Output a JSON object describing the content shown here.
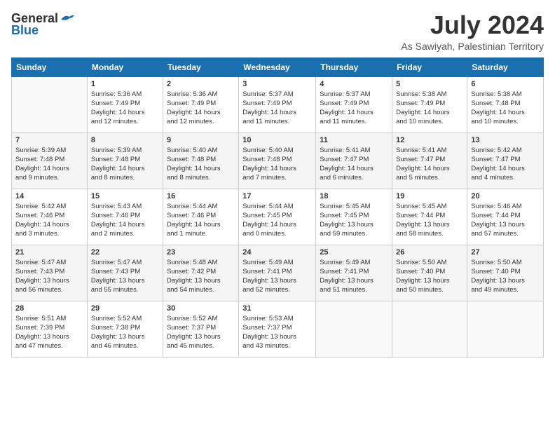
{
  "header": {
    "logo_general": "General",
    "logo_blue": "Blue",
    "month": "July 2024",
    "location": "As Sawiyah, Palestinian Territory"
  },
  "days_of_week": [
    "Sunday",
    "Monday",
    "Tuesday",
    "Wednesday",
    "Thursday",
    "Friday",
    "Saturday"
  ],
  "weeks": [
    [
      {
        "day": "",
        "info": ""
      },
      {
        "day": "1",
        "info": "Sunrise: 5:36 AM\nSunset: 7:49 PM\nDaylight: 14 hours\nand 12 minutes."
      },
      {
        "day": "2",
        "info": "Sunrise: 5:36 AM\nSunset: 7:49 PM\nDaylight: 14 hours\nand 12 minutes."
      },
      {
        "day": "3",
        "info": "Sunrise: 5:37 AM\nSunset: 7:49 PM\nDaylight: 14 hours\nand 11 minutes."
      },
      {
        "day": "4",
        "info": "Sunrise: 5:37 AM\nSunset: 7:49 PM\nDaylight: 14 hours\nand 11 minutes."
      },
      {
        "day": "5",
        "info": "Sunrise: 5:38 AM\nSunset: 7:49 PM\nDaylight: 14 hours\nand 10 minutes."
      },
      {
        "day": "6",
        "info": "Sunrise: 5:38 AM\nSunset: 7:48 PM\nDaylight: 14 hours\nand 10 minutes."
      }
    ],
    [
      {
        "day": "7",
        "info": "Sunrise: 5:39 AM\nSunset: 7:48 PM\nDaylight: 14 hours\nand 9 minutes."
      },
      {
        "day": "8",
        "info": "Sunrise: 5:39 AM\nSunset: 7:48 PM\nDaylight: 14 hours\nand 8 minutes."
      },
      {
        "day": "9",
        "info": "Sunrise: 5:40 AM\nSunset: 7:48 PM\nDaylight: 14 hours\nand 8 minutes."
      },
      {
        "day": "10",
        "info": "Sunrise: 5:40 AM\nSunset: 7:48 PM\nDaylight: 14 hours\nand 7 minutes."
      },
      {
        "day": "11",
        "info": "Sunrise: 5:41 AM\nSunset: 7:47 PM\nDaylight: 14 hours\nand 6 minutes."
      },
      {
        "day": "12",
        "info": "Sunrise: 5:41 AM\nSunset: 7:47 PM\nDaylight: 14 hours\nand 5 minutes."
      },
      {
        "day": "13",
        "info": "Sunrise: 5:42 AM\nSunset: 7:47 PM\nDaylight: 14 hours\nand 4 minutes."
      }
    ],
    [
      {
        "day": "14",
        "info": "Sunrise: 5:42 AM\nSunset: 7:46 PM\nDaylight: 14 hours\nand 3 minutes."
      },
      {
        "day": "15",
        "info": "Sunrise: 5:43 AM\nSunset: 7:46 PM\nDaylight: 14 hours\nand 2 minutes."
      },
      {
        "day": "16",
        "info": "Sunrise: 5:44 AM\nSunset: 7:46 PM\nDaylight: 14 hours\nand 1 minute."
      },
      {
        "day": "17",
        "info": "Sunrise: 5:44 AM\nSunset: 7:45 PM\nDaylight: 14 hours\nand 0 minutes."
      },
      {
        "day": "18",
        "info": "Sunrise: 5:45 AM\nSunset: 7:45 PM\nDaylight: 13 hours\nand 59 minutes."
      },
      {
        "day": "19",
        "info": "Sunrise: 5:45 AM\nSunset: 7:44 PM\nDaylight: 13 hours\nand 58 minutes."
      },
      {
        "day": "20",
        "info": "Sunrise: 5:46 AM\nSunset: 7:44 PM\nDaylight: 13 hours\nand 57 minutes."
      }
    ],
    [
      {
        "day": "21",
        "info": "Sunrise: 5:47 AM\nSunset: 7:43 PM\nDaylight: 13 hours\nand 56 minutes."
      },
      {
        "day": "22",
        "info": "Sunrise: 5:47 AM\nSunset: 7:43 PM\nDaylight: 13 hours\nand 55 minutes."
      },
      {
        "day": "23",
        "info": "Sunrise: 5:48 AM\nSunset: 7:42 PM\nDaylight: 13 hours\nand 54 minutes."
      },
      {
        "day": "24",
        "info": "Sunrise: 5:49 AM\nSunset: 7:41 PM\nDaylight: 13 hours\nand 52 minutes."
      },
      {
        "day": "25",
        "info": "Sunrise: 5:49 AM\nSunset: 7:41 PM\nDaylight: 13 hours\nand 51 minutes."
      },
      {
        "day": "26",
        "info": "Sunrise: 5:50 AM\nSunset: 7:40 PM\nDaylight: 13 hours\nand 50 minutes."
      },
      {
        "day": "27",
        "info": "Sunrise: 5:50 AM\nSunset: 7:40 PM\nDaylight: 13 hours\nand 49 minutes."
      }
    ],
    [
      {
        "day": "28",
        "info": "Sunrise: 5:51 AM\nSunset: 7:39 PM\nDaylight: 13 hours\nand 47 minutes."
      },
      {
        "day": "29",
        "info": "Sunrise: 5:52 AM\nSunset: 7:38 PM\nDaylight: 13 hours\nand 46 minutes."
      },
      {
        "day": "30",
        "info": "Sunrise: 5:52 AM\nSunset: 7:37 PM\nDaylight: 13 hours\nand 45 minutes."
      },
      {
        "day": "31",
        "info": "Sunrise: 5:53 AM\nSunset: 7:37 PM\nDaylight: 13 hours\nand 43 minutes."
      },
      {
        "day": "",
        "info": ""
      },
      {
        "day": "",
        "info": ""
      },
      {
        "day": "",
        "info": ""
      }
    ]
  ]
}
